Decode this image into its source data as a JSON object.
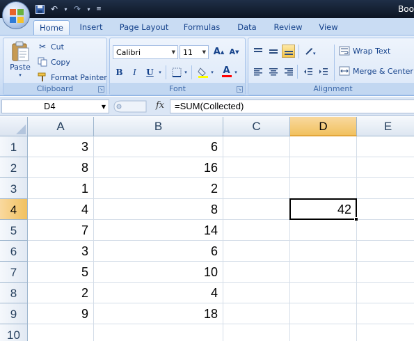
{
  "titlebar": {
    "title": "Boo",
    "qat": {
      "save_icon": "save-icon",
      "undo_icon": "undo-icon",
      "redo_icon": "redo-icon",
      "customize_icon": "customize-qat-icon"
    }
  },
  "tabs": [
    {
      "label": "Home",
      "active": true
    },
    {
      "label": "Insert"
    },
    {
      "label": "Page Layout"
    },
    {
      "label": "Formulas"
    },
    {
      "label": "Data"
    },
    {
      "label": "Review"
    },
    {
      "label": "View"
    }
  ],
  "ribbon": {
    "clipboard": {
      "label": "Clipboard",
      "paste": "Paste",
      "cut": "Cut",
      "copy": "Copy",
      "format_painter": "Format Painter"
    },
    "font": {
      "label": "Font",
      "family": "Calibri",
      "size": "11",
      "bold": "B",
      "italic": "I",
      "underline": "U",
      "grow": "A",
      "shrink": "A",
      "font_color_letter": "A",
      "highlight_color": "#ffff00",
      "font_color": "#ff0000"
    },
    "alignment": {
      "label": "Alignment",
      "wrap_text": "Wrap Text",
      "merge_center": "Merge & Center"
    }
  },
  "formula_bar": {
    "name_box": "D4",
    "fx": "fx",
    "formula": "=SUM(Collected)"
  },
  "sheet": {
    "columns": [
      "A",
      "B",
      "C",
      "D",
      "E"
    ],
    "active_column": "D",
    "active_row": 4,
    "rows": [
      {
        "num": "1",
        "A": "3",
        "B": "6",
        "C": "",
        "D": "",
        "E": ""
      },
      {
        "num": "2",
        "A": "8",
        "B": "16",
        "C": "",
        "D": "",
        "E": ""
      },
      {
        "num": "3",
        "A": "1",
        "B": "2",
        "C": "",
        "D": "",
        "E": ""
      },
      {
        "num": "4",
        "A": "4",
        "B": "8",
        "C": "",
        "D": "42",
        "E": ""
      },
      {
        "num": "5",
        "A": "7",
        "B": "14",
        "C": "",
        "D": "",
        "E": ""
      },
      {
        "num": "6",
        "A": "3",
        "B": "6",
        "C": "",
        "D": "",
        "E": ""
      },
      {
        "num": "7",
        "A": "5",
        "B": "10",
        "C": "",
        "D": "",
        "E": ""
      },
      {
        "num": "8",
        "A": "2",
        "B": "4",
        "C": "",
        "D": "",
        "E": ""
      },
      {
        "num": "9",
        "A": "9",
        "B": "18",
        "C": "",
        "D": "",
        "E": ""
      },
      {
        "num": "10",
        "A": "",
        "B": "",
        "C": "",
        "D": "",
        "E": ""
      }
    ]
  }
}
